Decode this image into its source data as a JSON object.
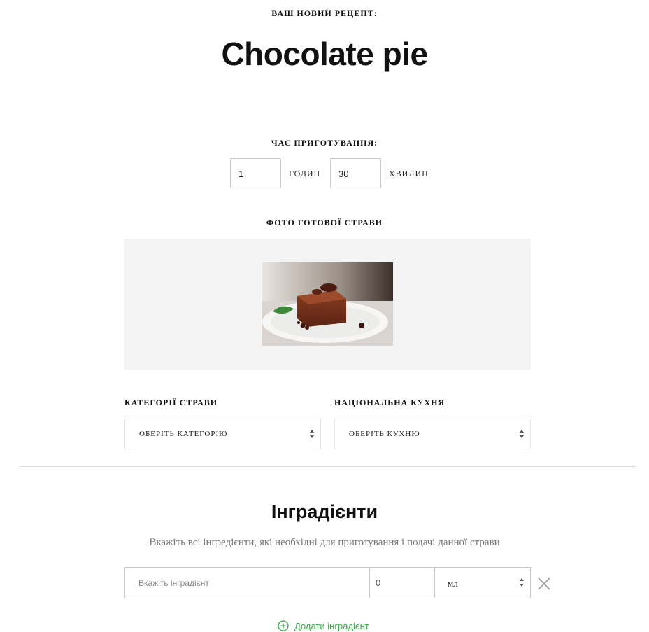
{
  "header": {
    "eyebrow": "ВАШ НОВИЙ РЕЦЕПТ:",
    "title": "Chocolate pie"
  },
  "cook_time": {
    "label": "ЧАС ПРИГОТУВАННЯ:",
    "hours_value": "1",
    "hours_unit": "ГОДИН",
    "minutes_value": "30",
    "minutes_unit": "ХВИЛИН"
  },
  "photo": {
    "label": "ФОТО ГОТОВОЇ СТРАВИ"
  },
  "category": {
    "label": "КАТЕГОРІЇ СТРАВИ",
    "selected": "ОБЕРІТЬ КАТЕГОРІЮ"
  },
  "cuisine": {
    "label": "НАЦІОНАЛЬНА КУХНЯ",
    "selected": "ОБЕРІТЬ КУХНЮ"
  },
  "ingredients": {
    "title": "Інградієнти",
    "hint": "Вкажіть всі інгредієнти, які необхідні для приготування і подачі данної страви",
    "name_placeholder": "Вкажіть інградієнт",
    "qty_value": "0",
    "unit_value": "мл",
    "add_label": "Додати інградієнт"
  },
  "colors": {
    "accent_green": "#3aa94a",
    "photo_bg": "#f4f4f4"
  }
}
